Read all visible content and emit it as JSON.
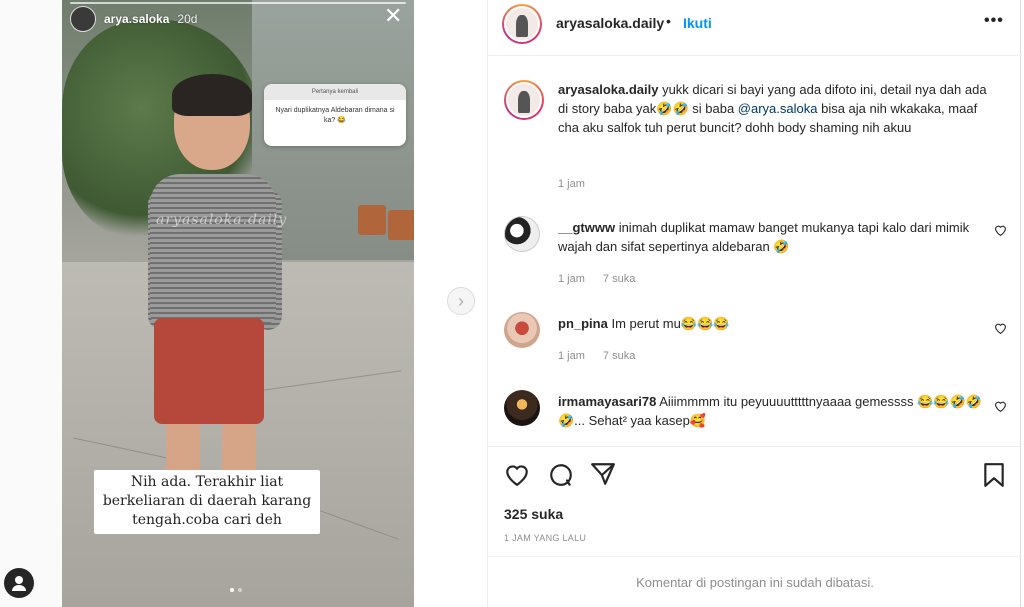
{
  "story": {
    "username": "arya.saloka",
    "age": "20d",
    "close_icon": "close-icon",
    "question_header": "Pertanya kembali",
    "question_text": "Nyari duplikatnya Aldebaran dimana si ka? 😂",
    "watermark": "aryasaloka.daily",
    "caption_lines": [
      "Nih ada. Terakhir liat",
      "berkeliaran di daerah karang",
      "tengah.coba cari deh"
    ]
  },
  "post": {
    "username": "aryasaloka.daily",
    "separator": "•",
    "follow_label": "Ikuti",
    "more_label": "•••",
    "caption": {
      "username": "aryasaloka.daily",
      "text_before": " yukk dicari si bayi yang ada difoto ini, detail nya dah ada di story baba yak🤣🤣 si baba ",
      "mention": "@arya.saloka",
      "text_after": " bisa aja nih wkakaka, maaf cha aku salfok tuh perut buncit? dohh body shaming nih akuu",
      "time": "1 jam"
    },
    "comments": [
      {
        "username": "__gtwww",
        "text": " inimah duplikat mamaw banget mukanya tapi kalo dari mimik wajah dan sifat sepertinya aldebaran 🤣",
        "time": "1 jam",
        "likes": "7 suka"
      },
      {
        "username": "pn_pina",
        "text": " Im perut mu😂😂😂",
        "time": "1 jam",
        "likes": "7 suka"
      },
      {
        "username": "irmamayasari78",
        "text": " Aiiimmmm itu peyuuuutttttnyaaaa gemessss 😂😂🤣🤣🤣... Sehat² yaa kasep🥰",
        "time": "",
        "likes": ""
      }
    ],
    "likes_count": "325 suka",
    "posted_ago": "1 JAM YANG LALU",
    "comments_closed": "Komentar di postingan ini sudah dibatasi."
  },
  "colors": {
    "accent": "#0095f6",
    "text": "#262626",
    "muted": "#8e8e8e"
  }
}
